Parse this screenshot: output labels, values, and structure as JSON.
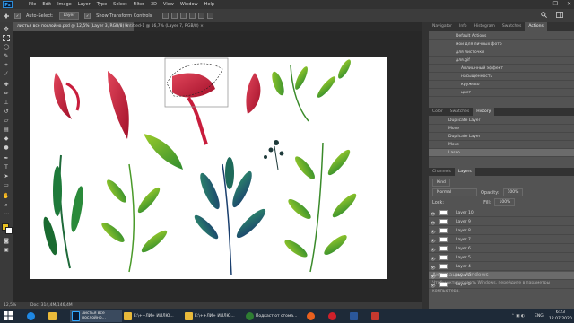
{
  "menubar": {
    "logo": "Ps",
    "items": [
      "File",
      "Edit",
      "Image",
      "Layer",
      "Type",
      "Select",
      "Filter",
      "3D",
      "View",
      "Window",
      "Help"
    ],
    "window_controls": [
      "—",
      "❐",
      "✕"
    ]
  },
  "options": {
    "auto_select_label": "Auto-Select:",
    "auto_select_value": "Layer",
    "transform_label": "Show Transform Controls"
  },
  "tabs": [
    {
      "label": "листья все послойно.psd @ 12,5% (Layer 3, RGB/8) ×",
      "active": true
    },
    {
      "label": "Untitled-1 @ 16,7% (Layer 7, RGB/8) ×",
      "active": false
    }
  ],
  "status": {
    "zoom": "12,5%",
    "doc": "Doc: 314,4M/146,4M"
  },
  "panels": {
    "top_tabs": [
      "Navigator",
      "Info",
      "Histogram",
      "Swatches",
      "Actions"
    ],
    "top_active": "Actions",
    "actions": [
      "Default Actions",
      "мои для личных фото",
      "для листочки",
      "для.gif",
      "Аплицнный эффект",
      "насыщенность",
      "кружево",
      "цвет"
    ],
    "mid_tabs": [
      "Color",
      "Swatches",
      "History"
    ],
    "mid_active": "History",
    "history": [
      "Duplicate Layer",
      "Move",
      "Duplicate Layer",
      "Move",
      "Lasso"
    ],
    "layer_tabs": [
      "Channels",
      "Layers"
    ],
    "layer_active": "Layers",
    "kind_label": "Kind",
    "blend_mode": "Normal",
    "opacity_label": "Opacity:",
    "opacity_value": "100%",
    "lock_label": "Lock:",
    "fill_label": "Fill:",
    "fill_value": "100%",
    "layers": [
      "Layer 10",
      "Layer 9",
      "Layer 8",
      "Layer 7",
      "Layer 6",
      "Layer 5",
      "Layer 4",
      "Layer 3",
      "Layer 2"
    ]
  },
  "watermark": {
    "line1": "Активация Windows",
    "line2": "Чтобы активировать Windows, перейдите в параметры",
    "line3": "компьютера."
  },
  "taskbar": {
    "items": [
      {
        "label": "листья все послойно...",
        "color": "#0a1a33"
      },
      {
        "label": "E:\\++ЛИ+ ИЛЛЮ...",
        "color": "#e8b93a"
      },
      {
        "label": "E:\\++ЛИ+ ИЛЛЮ...",
        "color": "#e8b93a"
      },
      {
        "label": "Подкаст от стома...",
        "color": "#2e7d32"
      }
    ],
    "lang": "ENG",
    "time": "6:23",
    "date": "12.07.2020"
  },
  "colors": {
    "leaf_red": "#c81d3c",
    "leaf_green": "#4caf28",
    "leaf_teal": "#1e6a5a",
    "selection": "#cc2233"
  }
}
